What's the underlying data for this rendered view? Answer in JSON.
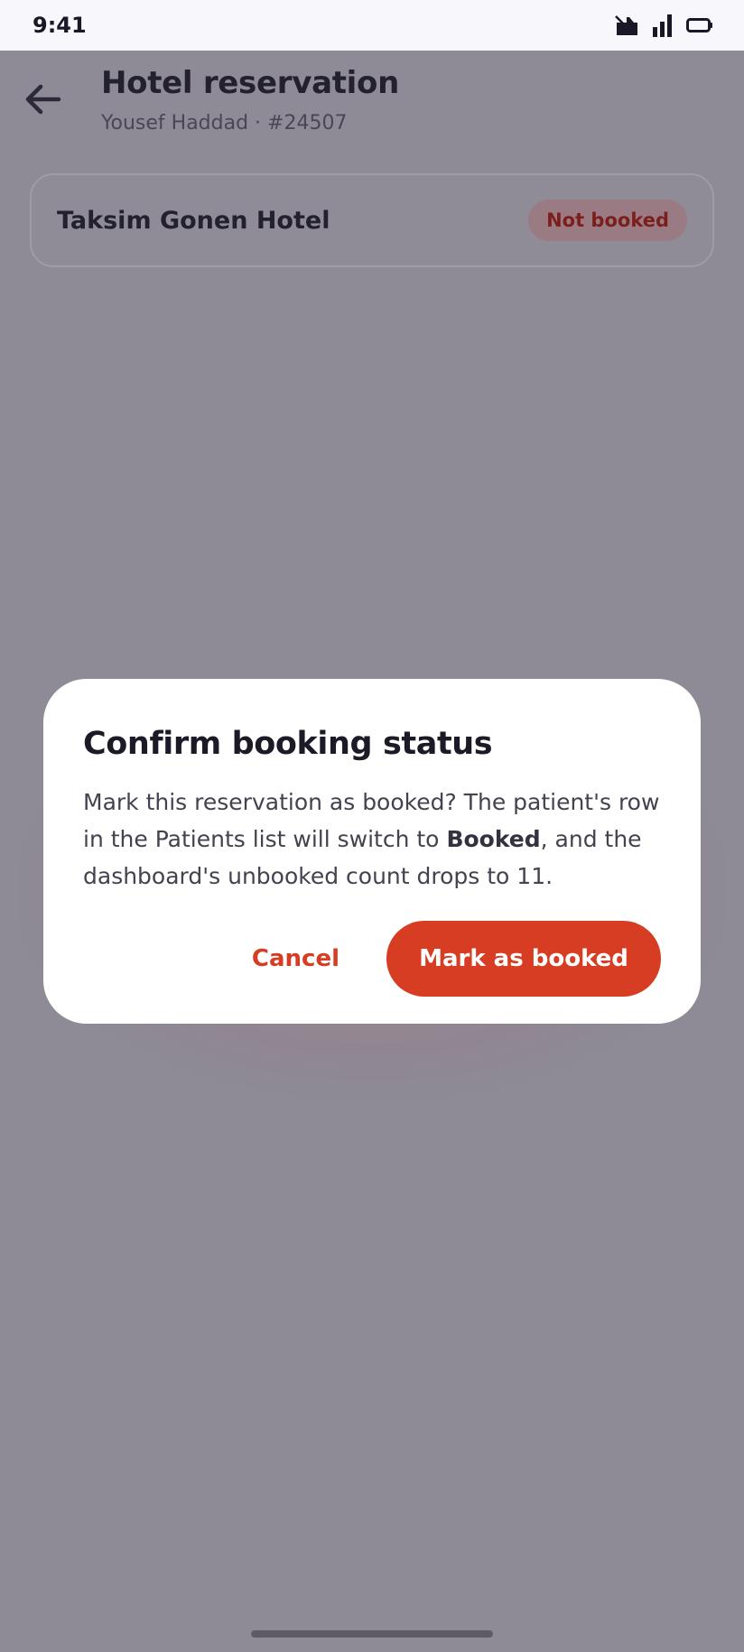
{
  "status_bar": {
    "time": "9:41",
    "icons": [
      "notification-icon",
      "signal-icon",
      "battery-icon"
    ]
  },
  "header": {
    "title": "Hotel reservation",
    "subtitle": "Yousef Haddad · #24507",
    "back_icon": "arrow-left-icon"
  },
  "card": {
    "hotel_name": "Taksim Gonen Hotel",
    "status": "Not booked"
  },
  "dialog": {
    "title": "Confirm booking status",
    "body_before": "Mark this reservation as booked? The patient's row in the Patients list will switch to ",
    "body_bold": "Booked",
    "body_after": ", and the dashboard's unbooked count drops to 11.",
    "cancel_label": "Cancel",
    "confirm_label": "Mark as booked"
  },
  "colors": {
    "accent": "#d63d22",
    "scrim": "#8e8b96",
    "badge_text": "#7c1f1c",
    "dialog_bg": "#ffffff"
  }
}
